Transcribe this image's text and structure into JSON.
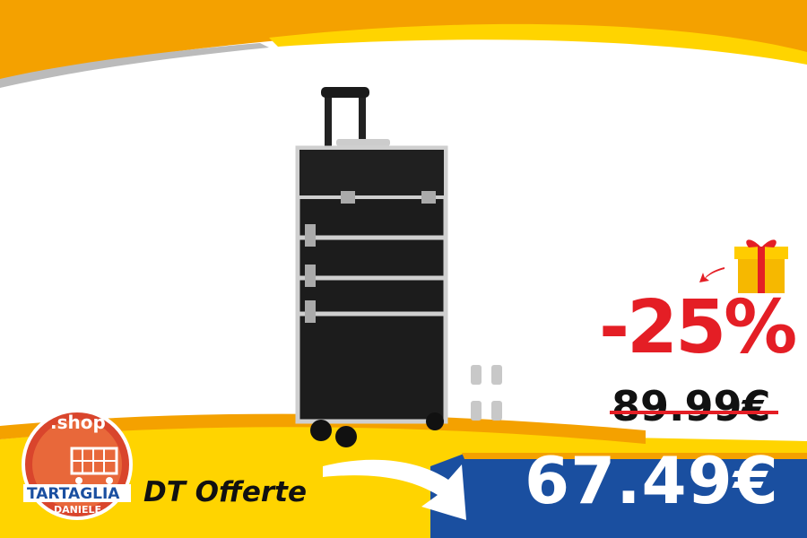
{
  "promo": {
    "discount": "-25%",
    "old_price": "89.99€",
    "new_price": "67.49€"
  },
  "brand": {
    "name": "DT Offerte",
    "logo_top": ".shop",
    "logo_main": "TARTAGLIA",
    "logo_sub": "DANIELE"
  },
  "product": {
    "icon": "trolley-makeup-case"
  },
  "colors": {
    "orange": "#f4a100",
    "yellow": "#ffd400",
    "blue": "#1a4fa0",
    "red": "#e41e25"
  }
}
